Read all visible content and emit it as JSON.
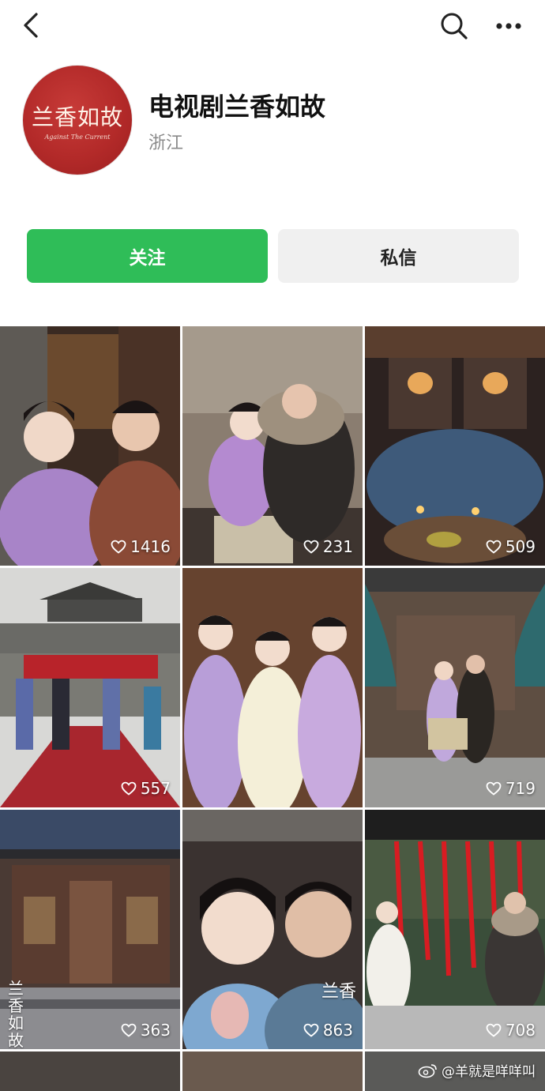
{
  "profile": {
    "name": "电视剧兰香如故",
    "location": "浙江",
    "avatar_title": "兰香如故",
    "avatar_subtitle": "Against The Current"
  },
  "actions": {
    "follow_label": "关注",
    "message_label": "私信"
  },
  "icons": [
    "back-icon",
    "search-icon",
    "more-icon",
    "heart-icon",
    "weibo-icon"
  ],
  "colors": {
    "follow_button": "#2fbd58",
    "message_button": "#f0f0f0",
    "avatar_red": "#b32a29"
  },
  "videos": [
    {
      "likes": "1416"
    },
    {
      "likes": "231"
    },
    {
      "likes": "509"
    },
    {
      "likes": "557"
    },
    {
      "likes": "719"
    },
    {
      "likes": "363",
      "overlay_text": "兰香如故"
    },
    {
      "likes": "863",
      "overlay_text": "兰香"
    },
    {
      "likes": "708"
    }
  ],
  "watermark": "@羊就是咩咩叫"
}
